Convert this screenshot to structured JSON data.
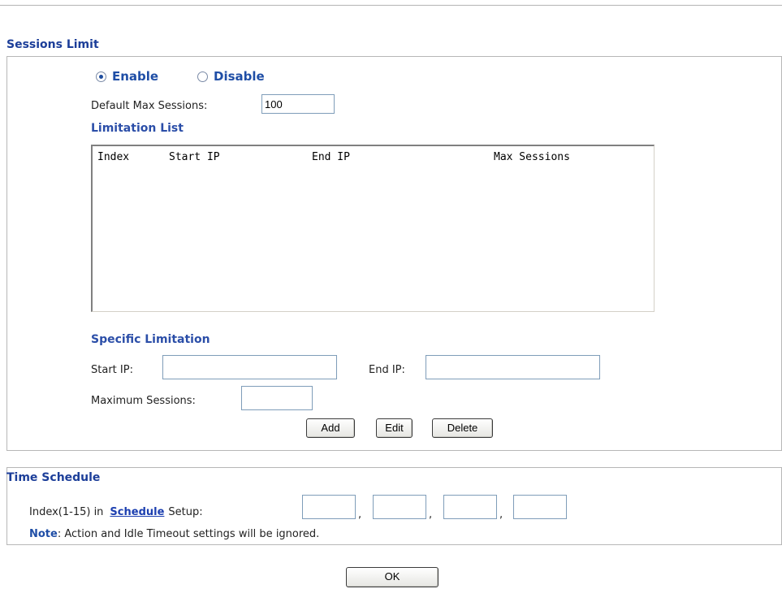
{
  "sessions_limit": {
    "title": "Sessions Limit",
    "enable_label": "Enable",
    "disable_label": "Disable",
    "selected": "Enable",
    "default_max_label": "Default Max Sessions:",
    "default_max_value": "100",
    "limitation_list_title": "Limitation List",
    "list_columns": [
      "Index",
      "Start IP",
      "End IP",
      "Max Sessions"
    ],
    "specific_title": "Specific Limitation",
    "start_ip_label": "Start IP:",
    "start_ip_value": "",
    "end_ip_label": "End IP:",
    "end_ip_value": "",
    "max_sessions_label": "Maximum Sessions:",
    "max_sessions_value": "",
    "add_label": "Add",
    "edit_label": "Edit",
    "delete_label": "Delete"
  },
  "time_schedule": {
    "title": "Time Schedule",
    "index_label_prefix": "Index(1-15) in",
    "schedule_link": "Schedule",
    "index_label_suffix": "Setup:",
    "separator": ",",
    "slots": [
      "",
      "",
      "",
      ""
    ],
    "note_label": "Note",
    "note_text": ": Action and Idle Timeout settings will be ignored."
  },
  "footer": {
    "ok_label": "OK"
  }
}
